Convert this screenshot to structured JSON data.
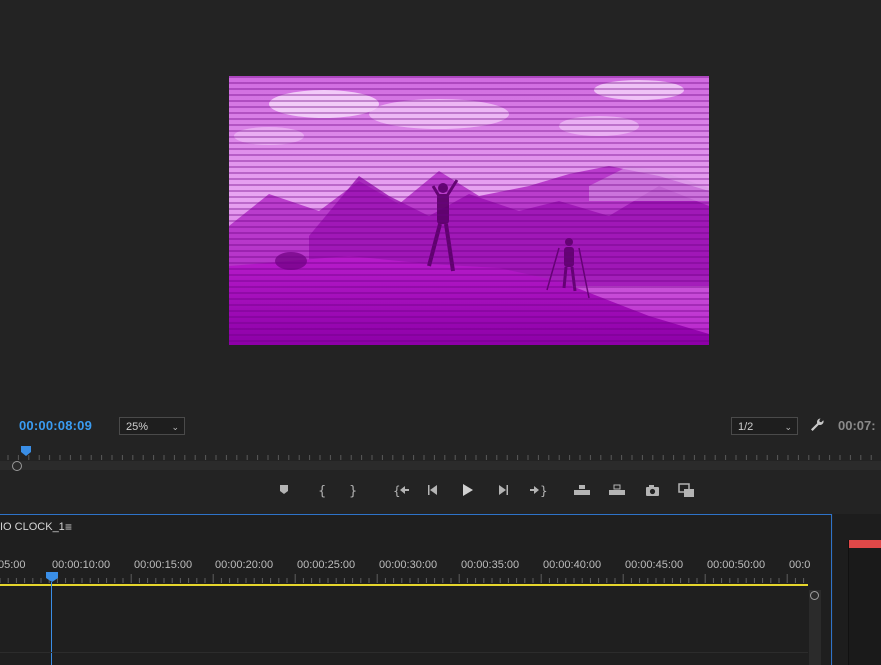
{
  "monitor": {
    "timecode_current": "00:00:08:09",
    "zoom_select": "25%",
    "resolution_select": "1/2",
    "timecode_duration": "00:07:",
    "playhead_fraction": 0.03
  },
  "transport": [
    {
      "name": "add-marker-button",
      "icon": "marker-icon"
    },
    {
      "name": "mark-in-button",
      "icon": "mark-in-icon"
    },
    {
      "name": "mark-out-button",
      "icon": "mark-out-icon"
    },
    {
      "name": "go-to-in-button",
      "icon": "go-to-in-icon"
    },
    {
      "name": "step-back-button",
      "icon": "step-back-icon"
    },
    {
      "name": "play-button",
      "icon": "play-icon"
    },
    {
      "name": "step-forward-button",
      "icon": "step-forward-icon"
    },
    {
      "name": "go-to-out-button",
      "icon": "go-to-out-icon"
    },
    {
      "name": "lift-button",
      "icon": "lift-icon"
    },
    {
      "name": "extract-button",
      "icon": "extract-icon"
    },
    {
      "name": "export-frame-button",
      "icon": "camera-icon"
    },
    {
      "name": "comparison-view-button",
      "icon": "comparison-view-icon"
    }
  ],
  "timeline": {
    "sequence_tab": "IO CLOCK_1",
    "menu_icon": "hamburger-icon",
    "ruler_labels": [
      "05:00",
      "00:00:10:00",
      "00:00:15:00",
      "00:00:20:00",
      "00:00:25:00",
      "00:00:30:00",
      "00:00:35:00",
      "00:00:40:00",
      "00:00:45:00",
      "00:00:50:00",
      "00:0"
    ],
    "colors": {
      "playhead": "#3a8ee6",
      "work_area": "#e5d52c",
      "accent_border": "#2e73c9"
    }
  },
  "colors": {
    "timecode": "#3a9cf2",
    "video_tint": "#b000c8",
    "right_panel_marker": "#e04848"
  }
}
